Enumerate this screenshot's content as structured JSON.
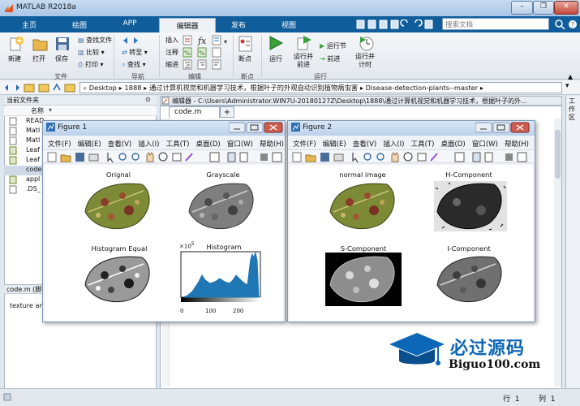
{
  "window": {
    "title": "MATLAB R2018a",
    "controls": [
      "–",
      "❐",
      "✕"
    ]
  },
  "ribbon_tabs": [
    {
      "label": "主页"
    },
    {
      "label": "绘图"
    },
    {
      "label": "APP"
    },
    {
      "label": "编辑器"
    },
    {
      "label": "发布"
    },
    {
      "label": "视图"
    }
  ],
  "search": {
    "placeholder": "搜索文档"
  },
  "ribbon": {
    "file": {
      "new": "新建",
      "open": "打开",
      "save": "保存",
      "find_files": "查找文件",
      "compare": "比较",
      "print": "打印",
      "section": "文件"
    },
    "navigate": {
      "goto": "转至",
      "find": "查找",
      "section": "导航"
    },
    "edit": {
      "insert": "插入",
      "comment": "注释",
      "indent": "缩进",
      "section": "编辑",
      "fx": "fx"
    },
    "breakpoints": {
      "label": "断点",
      "section": "断点"
    },
    "run": {
      "run": "运行",
      "run_advance": "运行并\n前进",
      "run_section": "运行节",
      "advance": "前进",
      "run_time": "运行并\n计时",
      "section": "运行"
    }
  },
  "path": {
    "segments": [
      "Desktop",
      "1888",
      "通过计算机视觉和机器学习技术，根据叶子的外观自动识别植物病虫害",
      "Disease-detection-plants--master"
    ],
    "separator": "▸"
  },
  "left_panel": {
    "title": "当前文件夹",
    "column": "名称",
    "files": [
      "READ",
      "Matl",
      "Matl",
      "Leaf",
      "Leaf",
      "code",
      "appl",
      ".DS_"
    ],
    "detail_title": "code.m  (脚",
    "detail_text": "texture an"
  },
  "editor": {
    "header": "编辑器 - C:\\Users\\Administrator.WIN7U-20180127Z\\Desktop\\1888\\通过计算机视觉和机器学习技术，根据叶子的外...",
    "tab": "code.m",
    "add": "+"
  },
  "workspace_label": "工作区",
  "figure_menu": [
    "文件(F)",
    "编辑(E)",
    "查看(V)",
    "插入(I)",
    "工具(T)",
    "桌面(D)",
    "窗口(W)",
    "帮助(H)"
  ],
  "figure1": {
    "title": "Figure 1",
    "plots": [
      "Orignal",
      "Grayscale",
      "Histogram Equal",
      "Histogram"
    ],
    "histogram": {
      "exponent": "×10",
      "exponent_power": "5",
      "ticks": [
        "0",
        "100",
        "200"
      ]
    }
  },
  "figure2": {
    "title": "Figure 2",
    "plots": [
      "normal image",
      "H-Component",
      "S-Component",
      "I-Component"
    ]
  },
  "status": {
    "line_label": "行",
    "line": "1",
    "col_label": "列",
    "col": "1"
  },
  "watermark": {
    "text": "必过源码",
    "url": "Biguo100.com"
  },
  "colors": {
    "tab_strip": "#0f5d9b",
    "accent": "#0c67b6",
    "histogram": "#1f77b4"
  }
}
